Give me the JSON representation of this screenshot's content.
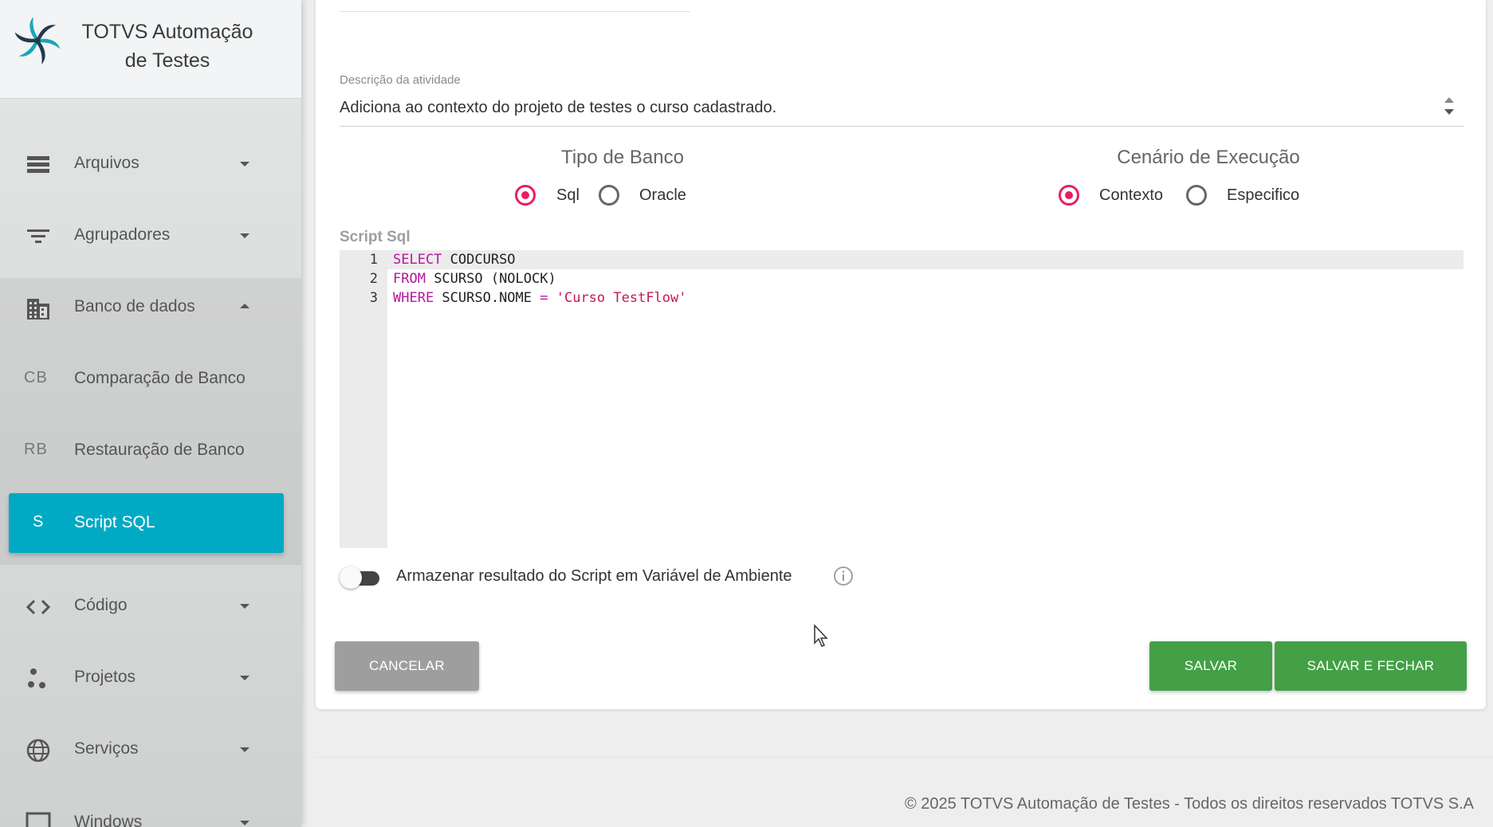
{
  "app": {
    "title_line1": "TOTVS Automação",
    "title_line2": "de Testes"
  },
  "sidebar": {
    "items": [
      {
        "label": "Arquivos",
        "icon": "list-icon"
      },
      {
        "label": "Agrupadores",
        "icon": "filter-icon"
      },
      {
        "label": "Banco de dados",
        "icon": "building-icon"
      },
      {
        "abbr": "CB",
        "label": "Comparação de Banco"
      },
      {
        "abbr": "RB",
        "label": "Restauração de Banco"
      },
      {
        "abbr": "S",
        "label": "Script SQL"
      },
      {
        "label": "Código",
        "icon": "code-icon"
      },
      {
        "label": "Projetos",
        "icon": "dots-icon"
      },
      {
        "label": "Serviços",
        "icon": "globe-icon"
      },
      {
        "label": "Windows",
        "icon": "window-icon"
      }
    ],
    "active_color": "#00aac4"
  },
  "form": {
    "description_label": "Descrição da atividade",
    "description_value": "Adiciona ao contexto do projeto de testes o curso cadastrado.",
    "db_type": {
      "title": "Tipo de Banco",
      "options": [
        "Sql",
        "Oracle"
      ],
      "selected": "Sql"
    },
    "scenario": {
      "title": "Cenário de Execução",
      "options": [
        "Contexto",
        "Especifico"
      ],
      "selected": "Contexto"
    },
    "script_label": "Script Sql",
    "script_lines": [
      {
        "num": "1",
        "kw": "SELECT",
        "rest": " CODCURSO"
      },
      {
        "num": "2",
        "kw": "FROM",
        "rest": " SCURSO (NOLOCK)"
      },
      {
        "num": "3",
        "kw": "WHERE",
        "rest": " SCURSO.NOME ",
        "op": "=",
        "str": " 'Curso TestFlow'"
      }
    ],
    "toggle_label": "Armazenar resultado do Script em Variável de Ambiente",
    "toggle_on": false
  },
  "buttons": {
    "cancel": "CANCELAR",
    "save": "SALVAR",
    "save_close": "SALVAR E FECHAR"
  },
  "colors": {
    "primary_radio": "#e91e63",
    "success": "#43a047",
    "cancel": "#9e9e9e"
  },
  "footer": {
    "text": "© 2025 TOTVS Automação de Testes - Todos os direitos reservados TOTVS S.A"
  }
}
